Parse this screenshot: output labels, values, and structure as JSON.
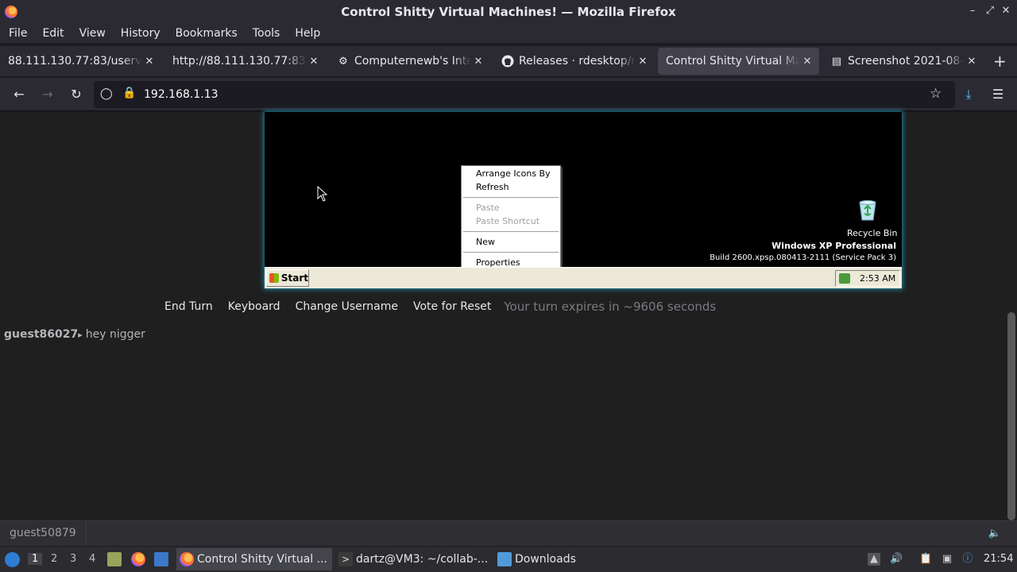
{
  "window": {
    "title": "Control Shitty Virtual Machines! — Mozilla Firefox",
    "controls": [
      "minimize-icon",
      "maximize-icon",
      "close-icon"
    ]
  },
  "menubar": {
    "items": [
      "File",
      "Edit",
      "View",
      "History",
      "Bookmarks",
      "Tools",
      "Help"
    ]
  },
  "tabs": [
    {
      "label": "88.111.130.77:83/uservm",
      "icon": "none",
      "active": false
    },
    {
      "label": "http://88.111.130.77:83/u",
      "icon": "none",
      "active": false
    },
    {
      "label": "Computernewb's Inter",
      "icon": "site-favicon-icon",
      "active": false
    },
    {
      "label": "Releases · rdesktop/rd",
      "icon": "github-icon",
      "active": false
    },
    {
      "label": "Control Shitty Virtual Mac",
      "icon": "none",
      "active": true
    },
    {
      "label": "Screenshot 2021-08-2",
      "icon": "image-file-icon",
      "active": false
    }
  ],
  "navbar": {
    "url": "192.168.1.13"
  },
  "vm": {
    "context_menu": {
      "items": [
        {
          "label": "Arrange Icons By",
          "disabled": false,
          "submenu": true
        },
        {
          "label": "Refresh",
          "disabled": false,
          "submenu": false
        },
        {
          "label": "Paste",
          "disabled": true,
          "submenu": false
        },
        {
          "label": "Paste Shortcut",
          "disabled": true,
          "submenu": false
        },
        {
          "label": "New",
          "disabled": false,
          "submenu": true
        },
        {
          "label": "Properties",
          "disabled": false,
          "submenu": false
        }
      ]
    },
    "recycle_bin_label": "Recycle Bin",
    "edition": "Windows XP Professional",
    "build": "Build 2600.xpsp.080413-2111 (Service Pack 3)",
    "start_label": "Start",
    "time": "2:53 AM"
  },
  "actions": {
    "end_turn": "End Turn",
    "keyboard": "Keyboard",
    "change_username": "Change Username",
    "vote_reset": "Vote for Reset",
    "turn_status": "Your turn expires in ~9606 seconds"
  },
  "chat": {
    "messages": [
      {
        "user": "guest86027",
        "separator": "▸",
        "text": "hey nigger"
      }
    ],
    "current_username": "guest50879"
  },
  "os_taskbar": {
    "workspaces": [
      "1",
      "2",
      "3",
      "4"
    ],
    "active_workspace": "1",
    "tasks": [
      {
        "label": "Control Shitty Virtual ...",
        "icon": "firefox-icon",
        "active": true
      },
      {
        "label": "dartz@VM3: ~/collab-...",
        "icon": "terminal-icon",
        "active": false
      },
      {
        "label": "Downloads",
        "icon": "folder-icon",
        "active": false
      }
    ],
    "clock": "21:54"
  },
  "colors": {
    "chrome_bg": "#2b2a33",
    "page_bg": "#1f1f1f",
    "vm_glow": "#1e8ea8",
    "xp_taskbar": "#ece9d8"
  }
}
